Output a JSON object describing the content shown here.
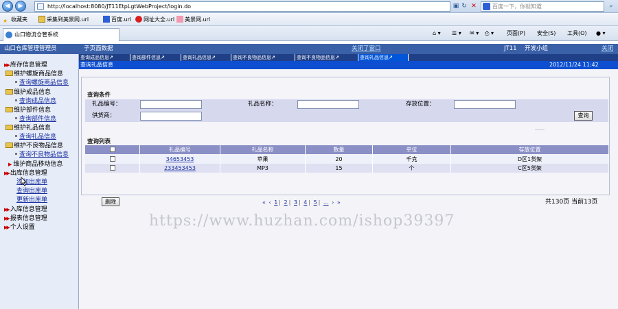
{
  "browser": {
    "url": "http://localhost:8080/JT11EtpLgtWebProject/login.do",
    "search_placeholder": "百度一下，你就知道",
    "favorites_label": "收藏夹",
    "favorites": [
      "采集到美景网.url",
      "百度.url",
      "网址大全.url",
      "美景网.url"
    ],
    "tab_title": "山口物流仓管系统",
    "commands": [
      "页面(P)",
      "安全(S)",
      "工具(O)"
    ]
  },
  "header": {
    "admin_label": "山口仓库管理管理员",
    "subpage_label": "子页面数据",
    "close_all": "关闭了窗口",
    "code": "JT11",
    "team": "开发小组",
    "close": "关闭"
  },
  "sidebar": {
    "inventory": "库存信息管理",
    "maintain_product": "维护螺旋商品信息",
    "query_product": "查询螺旋商品信息",
    "maintain_finished": "维护成品信息",
    "query_finished": "查询成品信息",
    "maintain_parts": "维护部件信息",
    "query_parts": "查询部件信息",
    "maintain_gift": "维护礼品信息",
    "query_gift": "查询礼品信息",
    "maintain_defect": "维护不良物品信息",
    "query_defect": "查询不良物品信息",
    "maintain_move": "维护商品移动信息",
    "outbound": "出库信息管理",
    "add_outbound": "添加出库单",
    "query_outbound": "查询出库单",
    "update_outbound": "更新出库单",
    "inbound": "入库信息管理",
    "report": "报表信息管理",
    "personal": "个人设置"
  },
  "subtabs": [
    "查询成品信息",
    "查询部件信息",
    "查询礼品信息",
    "查询不良物品信息",
    "查询不良物品信息",
    "查询礼品信息"
  ],
  "page_title": "查询礼品信息",
  "datetime": "2012/11/24 11:42",
  "query": {
    "section": "查询条件",
    "gift_no_label": "礼品编号：",
    "gift_name_label": "礼品名称：",
    "location_label": "存放位置：",
    "supplier_label": "供货商：",
    "search_button": "查询"
  },
  "list": {
    "section": "查询列表",
    "columns": [
      "礼品编号",
      "礼品名称",
      "数量",
      "单位",
      "存放位置"
    ],
    "rows": [
      {
        "no": "34653453",
        "name": "苹果",
        "qty": "20",
        "unit": "千克",
        "location": "D区1货架"
      },
      {
        "no": "233453453",
        "name": "MP3",
        "qty": "15",
        "unit": "个",
        "location": "C区5货架"
      }
    ],
    "delete_button": "删除"
  },
  "pager": {
    "first": "«",
    "prev": "‹",
    "pages": [
      "1",
      "2",
      "3",
      "4",
      "5",
      "..."
    ],
    "next": "›",
    "last": "»",
    "total": "共130页",
    "current": "当前13页"
  },
  "watermark": "https://www.huzhan.com/ishop39397"
}
